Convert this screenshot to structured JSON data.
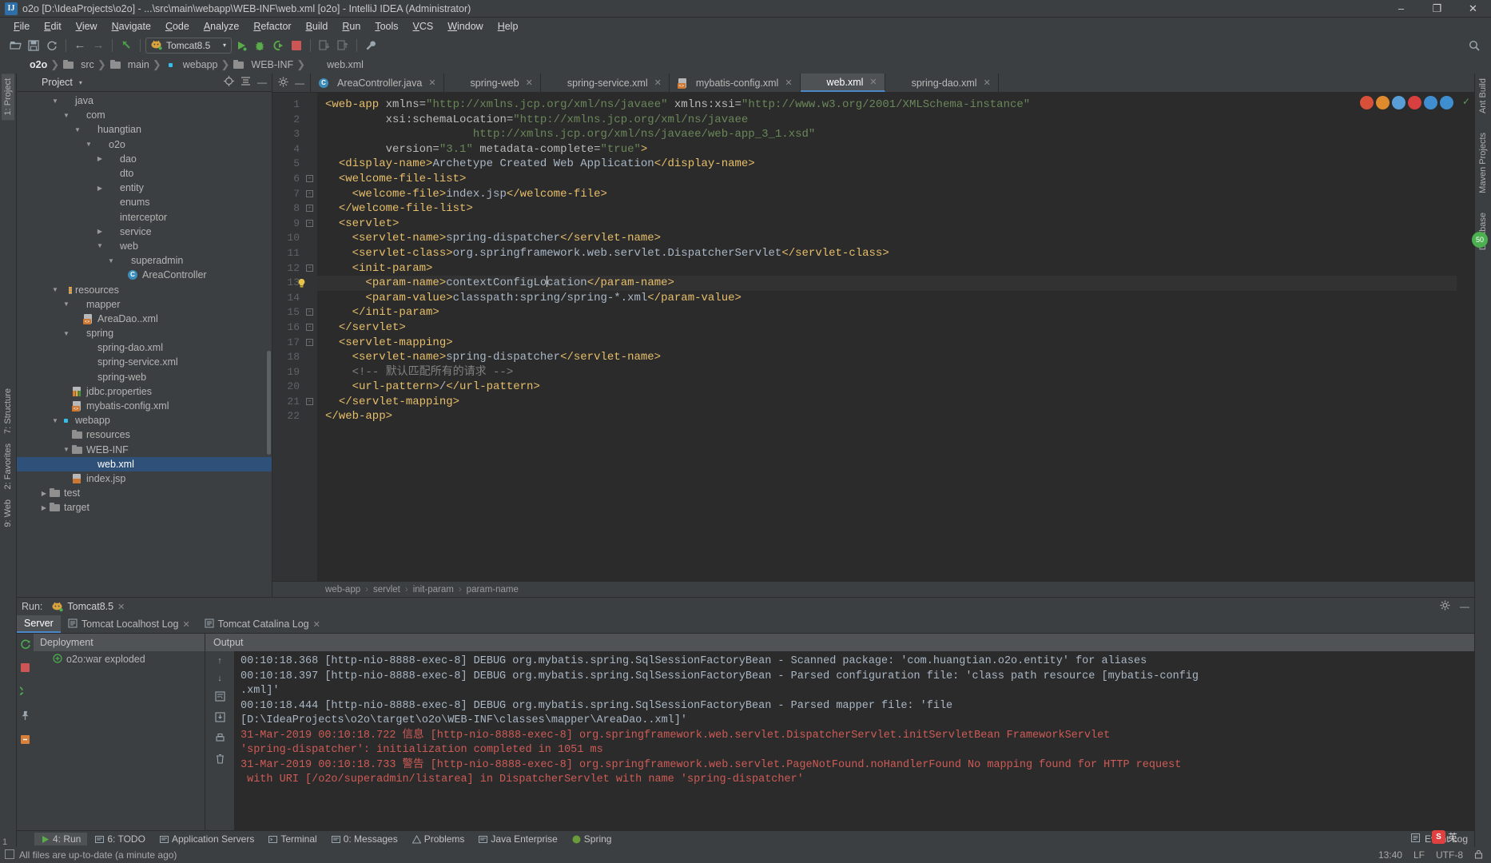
{
  "window": {
    "title": "o2o [D:\\IdeaProjects\\o2o] - ...\\src\\main\\webapp\\WEB-INF\\web.xml [o2o] - IntelliJ IDEA (Administrator)",
    "app_icon_letter": "IJ",
    "minimize": "–",
    "maximize": "❐",
    "close": "✕"
  },
  "menu": {
    "items": [
      "File",
      "Edit",
      "View",
      "Navigate",
      "Code",
      "Analyze",
      "Refactor",
      "Build",
      "Run",
      "Tools",
      "VCS",
      "Window",
      "Help"
    ]
  },
  "toolbar": {
    "open_icon": "open-folder-icon",
    "save_icon": "save-icon",
    "sync_icon": "sync-icon",
    "back_icon": "←",
    "forward_icon": "→",
    "revert_icon": "↖",
    "run_config_name": "Tomcat8.5",
    "run_config_caret": "▾",
    "run_icon": "▶",
    "debug_icon": "debug-bug-icon",
    "coverage_icon": "coverage-icon",
    "stop_icon": "stop-icon",
    "settings_icon": "wrench-icon",
    "search_icon": "magnifier-icon"
  },
  "breadcrumb": {
    "items": [
      "o2o",
      "src",
      "main",
      "webapp",
      "WEB-INF",
      "web.xml"
    ],
    "separator": "❯"
  },
  "left_strip": {
    "tabs": [
      "1: Project",
      "7: Structure",
      "2: Favorites",
      "9: Web"
    ],
    "bottom_number": "1"
  },
  "right_strip": {
    "tabs": [
      "Ant Build",
      "Maven Projects",
      "Database"
    ]
  },
  "project_panel": {
    "title": "Project",
    "caret": "▾",
    "target_icon": "crosshair-icon",
    "collapse_icon": "collapse-all-icon",
    "hide_icon": "—",
    "tree": [
      {
        "label": "java",
        "depth": 3,
        "arrow": "▼",
        "icon": "folder-src",
        "selected": false
      },
      {
        "label": "com",
        "depth": 4,
        "arrow": "▼",
        "icon": "folder-pkg",
        "selected": false
      },
      {
        "label": "huangtian",
        "depth": 5,
        "arrow": "▼",
        "icon": "folder-pkg",
        "selected": false
      },
      {
        "label": "o2o",
        "depth": 6,
        "arrow": "▼",
        "icon": "folder-pkg",
        "selected": false
      },
      {
        "label": "dao",
        "depth": 7,
        "arrow": "▶",
        "icon": "folder-pkg",
        "selected": false
      },
      {
        "label": "dto",
        "depth": 7,
        "arrow": "",
        "icon": "folder-pkg",
        "selected": false
      },
      {
        "label": "entity",
        "depth": 7,
        "arrow": "▶",
        "icon": "folder-pkg",
        "selected": false
      },
      {
        "label": "enums",
        "depth": 7,
        "arrow": "",
        "icon": "folder-pkg",
        "selected": false
      },
      {
        "label": "interceptor",
        "depth": 7,
        "arrow": "",
        "icon": "folder-pkg",
        "selected": false
      },
      {
        "label": "service",
        "depth": 7,
        "arrow": "▶",
        "icon": "folder-pkg",
        "selected": false
      },
      {
        "label": "web",
        "depth": 7,
        "arrow": "▼",
        "icon": "folder-pkg",
        "selected": false
      },
      {
        "label": "superadmin",
        "depth": 8,
        "arrow": "▼",
        "icon": "folder-pkg",
        "selected": false
      },
      {
        "label": "AreaController",
        "depth": 9,
        "arrow": "",
        "icon": "cls",
        "selected": false
      },
      {
        "label": "resources",
        "depth": 3,
        "arrow": "▼",
        "icon": "folder-res",
        "selected": false
      },
      {
        "label": "mapper",
        "depth": 4,
        "arrow": "▼",
        "icon": "folder-pkg",
        "selected": false
      },
      {
        "label": "AreaDao..xml",
        "depth": 5,
        "arrow": "",
        "icon": "xml",
        "selected": false
      },
      {
        "label": "spring",
        "depth": 4,
        "arrow": "▼",
        "icon": "folder-pkg",
        "selected": false
      },
      {
        "label": "spring-dao.xml",
        "depth": 5,
        "arrow": "",
        "icon": "xml-spring",
        "selected": false
      },
      {
        "label": "spring-service.xml",
        "depth": 5,
        "arrow": "",
        "icon": "xml-spring",
        "selected": false
      },
      {
        "label": "spring-web",
        "depth": 5,
        "arrow": "",
        "icon": "xml-spring",
        "selected": false
      },
      {
        "label": "jdbc.properties",
        "depth": 4,
        "arrow": "",
        "icon": "props",
        "selected": false
      },
      {
        "label": "mybatis-config.xml",
        "depth": 4,
        "arrow": "",
        "icon": "xml",
        "selected": false
      },
      {
        "label": "webapp",
        "depth": 3,
        "arrow": "▼",
        "icon": "folder-web",
        "selected": false
      },
      {
        "label": "resources",
        "depth": 4,
        "arrow": "",
        "icon": "folder",
        "selected": false
      },
      {
        "label": "WEB-INF",
        "depth": 4,
        "arrow": "▼",
        "icon": "folder",
        "selected": false
      },
      {
        "label": "web.xml",
        "depth": 5,
        "arrow": "",
        "icon": "xml-web",
        "selected": true
      },
      {
        "label": "index.jsp",
        "depth": 4,
        "arrow": "",
        "icon": "jsp",
        "selected": false
      },
      {
        "label": "test",
        "depth": 2,
        "arrow": "▶",
        "icon": "folder",
        "selected": false
      },
      {
        "label": "target",
        "depth": 2,
        "arrow": "▶",
        "icon": "folder",
        "selected": false
      }
    ]
  },
  "editor": {
    "tab_controls": {
      "settings_icon": "gear-icon",
      "hide_icon": "—"
    },
    "tabs": [
      {
        "label": "AreaController.java",
        "icon": "cls",
        "active": false,
        "close": "✕"
      },
      {
        "label": "spring-web",
        "icon": "xml-spring",
        "active": false,
        "close": "✕"
      },
      {
        "label": "spring-service.xml",
        "icon": "xml-spring",
        "active": false,
        "close": "✕"
      },
      {
        "label": "mybatis-config.xml",
        "icon": "xml",
        "active": false,
        "close": "✕"
      },
      {
        "label": "web.xml",
        "icon": "xml-web",
        "active": true,
        "close": "✕"
      },
      {
        "label": "spring-dao.xml",
        "icon": "xml-spring",
        "active": false,
        "close": "✕"
      }
    ],
    "line_numbers": [
      "1",
      "2",
      "3",
      "4",
      "5",
      "6",
      "7",
      "8",
      "9",
      "10",
      "11",
      "12",
      "13",
      "14",
      "15",
      "16",
      "17",
      "18",
      "19",
      "20",
      "21",
      "22"
    ],
    "highlighted_line": 13,
    "lines": [
      {
        "n": 1,
        "indent": 0,
        "parts": [
          {
            "t": "<web-app ",
            "c": "tag"
          },
          {
            "t": "xmlns=",
            "c": "attr"
          },
          {
            "t": "\"http://xmlns.jcp.org/xml/ns/javaee\"",
            "c": "str"
          },
          {
            "t": " xmlns:xsi=",
            "c": "attr"
          },
          {
            "t": "\"http://www.w3.org/2001/XMLSchema-instance\"",
            "c": "str"
          }
        ]
      },
      {
        "n": 2,
        "indent": 9,
        "parts": [
          {
            "t": "xsi:schemaLocation=",
            "c": "attr"
          },
          {
            "t": "\"http://xmlns.jcp.org/xml/ns/javaee",
            "c": "str"
          }
        ]
      },
      {
        "n": 3,
        "indent": 22,
        "parts": [
          {
            "t": "http://xmlns.jcp.org/xml/ns/javaee/web-app_3_1.xsd\"",
            "c": "str"
          }
        ]
      },
      {
        "n": 4,
        "indent": 9,
        "parts": [
          {
            "t": "version=",
            "c": "attr"
          },
          {
            "t": "\"3.1\"",
            "c": "str"
          },
          {
            "t": " metadata-complete=",
            "c": "attr"
          },
          {
            "t": "\"true\"",
            "c": "str"
          },
          {
            "t": ">",
            "c": "tag"
          }
        ]
      },
      {
        "n": 5,
        "indent": 2,
        "parts": [
          {
            "t": "<display-name>",
            "c": "tag"
          },
          {
            "t": "Archetype Created Web Application",
            "c": "txt"
          },
          {
            "t": "</display-name>",
            "c": "tag"
          }
        ]
      },
      {
        "n": 6,
        "indent": 2,
        "parts": [
          {
            "t": "<welcome-file-list>",
            "c": "tag"
          }
        ]
      },
      {
        "n": 7,
        "indent": 4,
        "parts": [
          {
            "t": "<welcome-file>",
            "c": "tag"
          },
          {
            "t": "index.jsp",
            "c": "txt"
          },
          {
            "t": "</welcome-file>",
            "c": "tag"
          }
        ]
      },
      {
        "n": 8,
        "indent": 2,
        "parts": [
          {
            "t": "</welcome-file-list>",
            "c": "tag"
          }
        ]
      },
      {
        "n": 9,
        "indent": 2,
        "parts": [
          {
            "t": "<servlet>",
            "c": "tag"
          }
        ]
      },
      {
        "n": 10,
        "indent": 4,
        "parts": [
          {
            "t": "<servlet-name>",
            "c": "tag"
          },
          {
            "t": "spring-dispatcher",
            "c": "txt"
          },
          {
            "t": "</servlet-name>",
            "c": "tag"
          }
        ]
      },
      {
        "n": 11,
        "indent": 4,
        "parts": [
          {
            "t": "<servlet-class>",
            "c": "tag"
          },
          {
            "t": "org.springframework.web.servlet.DispatcherServlet",
            "c": "txt"
          },
          {
            "t": "</servlet-class>",
            "c": "tag"
          }
        ]
      },
      {
        "n": 12,
        "indent": 4,
        "parts": [
          {
            "t": "<init-param>",
            "c": "tag"
          }
        ]
      },
      {
        "n": 13,
        "indent": 6,
        "parts": [
          {
            "t": "<param-name>",
            "c": "tag"
          },
          {
            "t": "contextConfigLo",
            "c": "txt"
          },
          {
            "t": "|CARET|",
            "c": "caret"
          },
          {
            "t": "cation",
            "c": "txt"
          },
          {
            "t": "</param-name>",
            "c": "tag"
          }
        ]
      },
      {
        "n": 14,
        "indent": 6,
        "parts": [
          {
            "t": "<param-value>",
            "c": "tag"
          },
          {
            "t": "classpath:spring/spring-*.xml",
            "c": "txt"
          },
          {
            "t": "</param-value>",
            "c": "tag"
          }
        ]
      },
      {
        "n": 15,
        "indent": 4,
        "parts": [
          {
            "t": "</init-param>",
            "c": "tag"
          }
        ]
      },
      {
        "n": 16,
        "indent": 2,
        "parts": [
          {
            "t": "</servlet>",
            "c": "tag"
          }
        ]
      },
      {
        "n": 17,
        "indent": 2,
        "parts": [
          {
            "t": "<servlet-mapping>",
            "c": "tag"
          }
        ]
      },
      {
        "n": 18,
        "indent": 4,
        "parts": [
          {
            "t": "<servlet-name>",
            "c": "tag"
          },
          {
            "t": "spring-dispatcher",
            "c": "txt"
          },
          {
            "t": "</servlet-name>",
            "c": "tag"
          }
        ]
      },
      {
        "n": 19,
        "indent": 4,
        "parts": [
          {
            "t": "<!-- 默认匹配所有的请求 -->",
            "c": "cmt"
          }
        ]
      },
      {
        "n": 20,
        "indent": 4,
        "parts": [
          {
            "t": "<url-pattern>",
            "c": "tag"
          },
          {
            "t": "/",
            "c": "txt"
          },
          {
            "t": "</url-pattern>",
            "c": "tag"
          }
        ]
      },
      {
        "n": 21,
        "indent": 2,
        "parts": [
          {
            "t": "</servlet-mapping>",
            "c": "tag"
          }
        ]
      },
      {
        "n": 22,
        "indent": 0,
        "parts": [
          {
            "t": "</web-app>",
            "c": "tag"
          }
        ]
      }
    ],
    "breadcrumb_path": [
      "web-app",
      "servlet",
      "init-param",
      "param-name"
    ],
    "breadcrumb_sep": "›",
    "browser_icons": [
      "chrome-icon",
      "firefox-icon",
      "opera-icon",
      "safari-icon",
      "edge-icon",
      "ie-icon"
    ],
    "browser_colors": [
      "#d8503a",
      "#e08a2e",
      "#5a9ed8",
      "#d84040",
      "#3f8fd0",
      "#3f8fd0"
    ],
    "inspection_status_color": "#5a9e5a"
  },
  "run_window": {
    "title": "Run:",
    "config_name": "Tomcat8.5",
    "config_close": "✕",
    "settings_icon": "gear-icon",
    "hide_icon": "—",
    "tabs": [
      {
        "label": "Server",
        "active": true,
        "close": ""
      },
      {
        "label": "Tomcat Localhost Log",
        "active": false,
        "close": "✕"
      },
      {
        "label": "Tomcat Catalina Log",
        "active": false,
        "close": "✕"
      }
    ],
    "deployment_header": "Deployment",
    "deployment_items": [
      "o2o:war exploded"
    ],
    "output_header": "Output",
    "console_lines": [
      {
        "text": "00:10:18.368 [http-nio-8888-exec-8] DEBUG org.mybatis.spring.SqlSessionFactoryBean - Scanned package: 'com.huangtian.o2o.entity' for aliases",
        "level": "info"
      },
      {
        "text": "00:10:18.397 [http-nio-8888-exec-8] DEBUG org.mybatis.spring.SqlSessionFactoryBean - Parsed configuration file: 'class path resource [mybatis-config",
        "level": "info"
      },
      {
        "text": ".xml]'",
        "level": "info"
      },
      {
        "text": "00:10:18.444 [http-nio-8888-exec-8] DEBUG org.mybatis.spring.SqlSessionFactoryBean - Parsed mapper file: 'file",
        "level": "info"
      },
      {
        "text": "[D:\\IdeaProjects\\o2o\\target\\o2o\\WEB-INF\\classes\\mapper\\AreaDao..xml]'",
        "level": "info"
      },
      {
        "text": "31-Mar-2019 00:10:18.722 信息 [http-nio-8888-exec-8] org.springframework.web.servlet.DispatcherServlet.initServletBean FrameworkServlet",
        "level": "err"
      },
      {
        "text": "'spring-dispatcher': initialization completed in 1051 ms",
        "level": "err"
      },
      {
        "text": "31-Mar-2019 00:10:18.733 警告 [http-nio-8888-exec-8] org.springframework.web.servlet.PageNotFound.noHandlerFound No mapping found for HTTP request",
        "level": "err"
      },
      {
        "text": " with URI [/o2o/superadmin/listarea] in DispatcherServlet with name 'spring-dispatcher'",
        "level": "err"
      }
    ]
  },
  "bottom_bar": {
    "tabs": [
      {
        "label": "4: Run",
        "icon": "run-icon",
        "selected": true
      },
      {
        "label": "6: TODO",
        "icon": "todo-icon",
        "selected": false
      },
      {
        "label": "Application Servers",
        "icon": "server-icon",
        "selected": false
      },
      {
        "label": "Terminal",
        "icon": "terminal-icon",
        "selected": false
      },
      {
        "label": "0: Messages",
        "icon": "messages-icon",
        "selected": false
      },
      {
        "label": "Problems",
        "icon": "problems-icon",
        "selected": false
      },
      {
        "label": "Java Enterprise",
        "icon": "java-ee-icon",
        "selected": false
      },
      {
        "label": "Spring",
        "icon": "spring-icon",
        "selected": false
      }
    ],
    "event_log": "Event Log",
    "event_log_icon": "event-log-icon"
  },
  "status_bar": {
    "message": "All files are up-to-date (a minute ago)",
    "message_icon": "info-icon",
    "time": "13:40",
    "line_sep": "LF",
    "encoding": "UTF-8",
    "lock_icon": "lock-icon",
    "ime_char": "英",
    "ime_badge": "S"
  }
}
